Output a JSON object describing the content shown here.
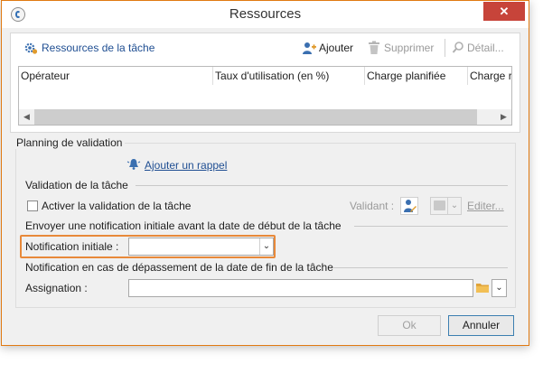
{
  "window": {
    "title": "Ressources",
    "close_glyph": "✕"
  },
  "toolbar": {
    "resources_link": "Ressources de la tâche",
    "add_label": "Ajouter",
    "delete_label": "Supprimer",
    "detail_label": "Détail..."
  },
  "table": {
    "columns": [
      "Opérateur",
      "Taux d'utilisation (en %)",
      "Charge planifiée",
      "Charge ré"
    ]
  },
  "planning": {
    "legend": "Planning de validation",
    "add_reminder_link": "Ajouter un rappel",
    "task_validation_heading": "Validation de la tâche",
    "activate_validation_label": "Activer la validation de la tâche",
    "validator_label": "Validant :",
    "edit_link": "Editer...",
    "initial_notification_heading": "Envoyer une notification initiale avant la date de début de la tâche",
    "initial_notification_label": "Notification initiale :",
    "initial_notification_value": "",
    "overdue_heading": "Notification en cas de dépassement de la date de fin de la tâche",
    "assignment_label": "Assignation :",
    "assignment_value": ""
  },
  "footer": {
    "ok_label": "Ok",
    "cancel_label": "Annuler"
  },
  "colors": {
    "highlight": "#e8893a",
    "link": "#1f4e92",
    "accent_border": "#e07a12"
  }
}
